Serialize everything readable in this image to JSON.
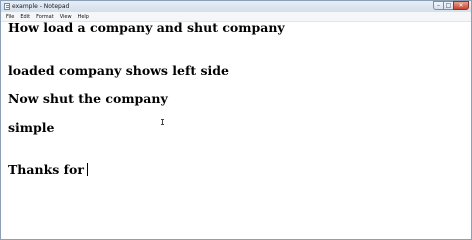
{
  "window": {
    "title": "example - Notepad",
    "controls": {
      "minimize": "–",
      "maximize": "□",
      "close": "✕"
    }
  },
  "menu": {
    "items": [
      {
        "label": "File"
      },
      {
        "label": "Edit"
      },
      {
        "label": "Format"
      },
      {
        "label": "View"
      },
      {
        "label": "Help"
      }
    ]
  },
  "document": {
    "lines": [
      "How load a company and shut company",
      "loaded company shows left side",
      "Now shut the company",
      "simple",
      "Thanks for"
    ]
  },
  "icons": {
    "app": "notepad-icon",
    "pointer": "ibeam-cursor-icon"
  },
  "colors": {
    "titlebar": "#d3dfec",
    "close_button": "#c7452e",
    "text": "#000000",
    "background": "#ffffff"
  }
}
